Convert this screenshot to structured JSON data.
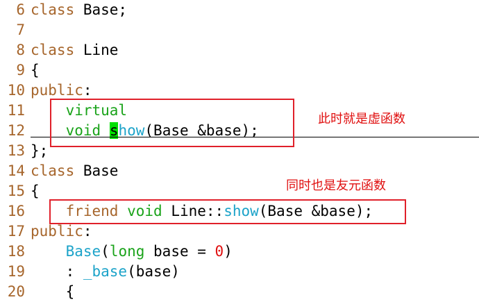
{
  "editor": {
    "lines": [
      {
        "n": "6",
        "parts": [
          [
            "class",
            "k-brown"
          ],
          [
            " Base;",
            ""
          ]
        ]
      },
      {
        "n": "7",
        "parts": []
      },
      {
        "n": "8",
        "parts": [
          [
            "class",
            "k-brown"
          ],
          [
            " Line",
            ""
          ]
        ]
      },
      {
        "n": "9",
        "parts": [
          [
            "{",
            ""
          ]
        ]
      },
      {
        "n": "10",
        "parts": [
          [
            "public",
            "k-brown"
          ],
          [
            ":",
            ""
          ]
        ]
      },
      {
        "n": "11",
        "parts": [
          [
            "    ",
            ""
          ],
          [
            "virtual",
            "k-green"
          ]
        ]
      },
      {
        "n": "12",
        "parts": [
          [
            "    ",
            ""
          ],
          [
            "void",
            "k-green"
          ],
          [
            " ",
            ""
          ],
          [
            "s",
            "cursor"
          ],
          [
            "how",
            "k-cyan"
          ],
          [
            "(Base &base);",
            ""
          ]
        ]
      },
      {
        "n": "13",
        "parts": [
          [
            "};",
            ""
          ]
        ]
      },
      {
        "n": "14",
        "parts": [
          [
            "class",
            "k-brown"
          ],
          [
            " Base",
            ""
          ]
        ]
      },
      {
        "n": "15",
        "parts": [
          [
            "{",
            ""
          ]
        ]
      },
      {
        "n": "16",
        "parts": [
          [
            "    ",
            ""
          ],
          [
            "friend",
            "k-brown"
          ],
          [
            " ",
            ""
          ],
          [
            "void",
            "k-green"
          ],
          [
            " Line::",
            ""
          ],
          [
            "show",
            "k-cyan"
          ],
          [
            "(Base &base);",
            ""
          ]
        ]
      },
      {
        "n": "17",
        "parts": [
          [
            "public",
            "k-brown"
          ],
          [
            ":",
            ""
          ]
        ]
      },
      {
        "n": "18",
        "parts": [
          [
            "    ",
            ""
          ],
          [
            "Base",
            "k-cyan"
          ],
          [
            "(",
            ""
          ],
          [
            "long",
            "k-green"
          ],
          [
            " base = ",
            ""
          ],
          [
            "0",
            "k-red"
          ],
          [
            ")",
            ""
          ]
        ]
      },
      {
        "n": "19",
        "parts": [
          [
            "    : ",
            ""
          ],
          [
            "_base",
            "k-cyan"
          ],
          [
            "(base)",
            ""
          ]
        ]
      },
      {
        "n": "20",
        "parts": [
          [
            "    {",
            ""
          ]
        ]
      }
    ]
  },
  "annotations": {
    "virtual_note": "此时就是虚函数",
    "friend_note": "同时也是友元函数"
  },
  "colors": {
    "line_number": "#a6652b",
    "keyword_brown": "#a6652b",
    "keyword_green": "#1aa31a",
    "identifier_cyan": "#1ca3c9",
    "number_red": "#e01010",
    "cursor": "#00e000",
    "annotation": "#e01010"
  }
}
